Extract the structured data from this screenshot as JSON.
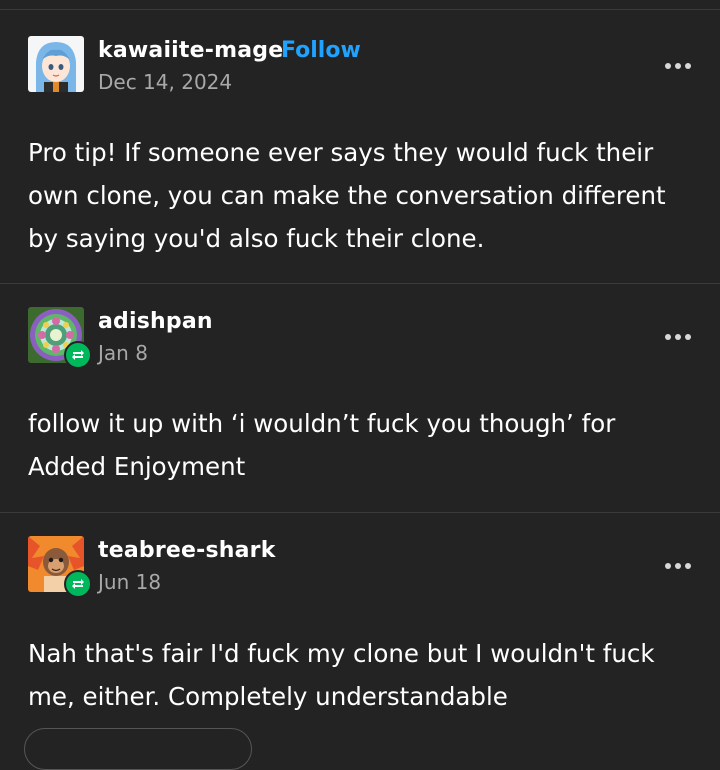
{
  "posts": [
    {
      "username": "kawaiite-mage",
      "follow_label": "Follow",
      "date": "Dec 14, 2024",
      "text_lines": [
        "Pro tip! If someone ever says they would fuck their",
        "own clone, you can make the conversation different",
        "by saying you'd also fuck their clone."
      ]
    },
    {
      "username": "adishpan",
      "date": "Jan 8",
      "text_lines": [
        "follow it up with ‘i wouldn’t fuck you though’ for",
        "Added Enjoyment"
      ]
    },
    {
      "username": "teabree-shark",
      "date": "Jun 18",
      "text_lines": [
        "Nah that's fair I'd fuck my clone but I wouldn't fuck",
        "me, either. Completely understandable"
      ]
    }
  ],
  "colors": {
    "background": "#232323",
    "follow": "#1fa3ff",
    "reblog_badge": "#00b85c",
    "date": "#a8a8a8"
  },
  "icons": {
    "more": "more-options-icon",
    "reblog": "reblog-icon"
  }
}
